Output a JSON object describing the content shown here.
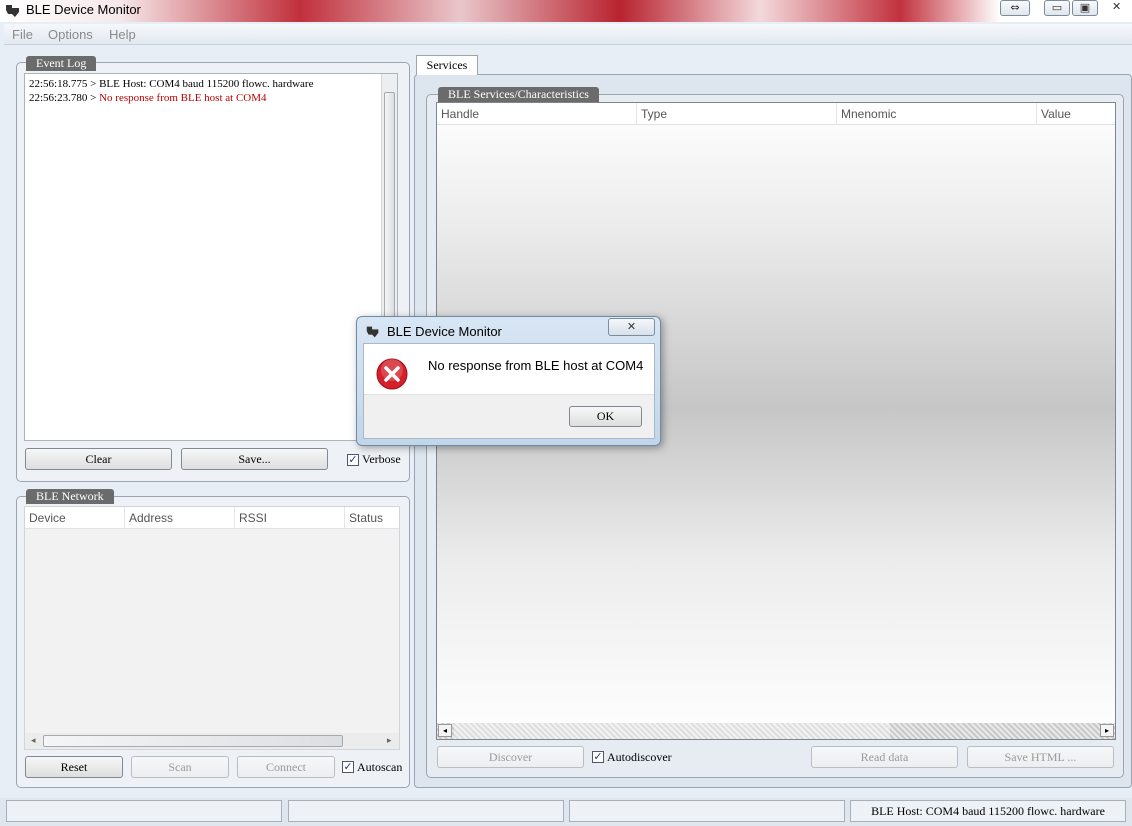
{
  "window": {
    "title": "BLE Device Monitor",
    "controls": {
      "restore_glyph": "⇔",
      "minimize_glyph": "▭",
      "maximize_glyph": "▣",
      "close_glyph": "✕"
    }
  },
  "menu": {
    "items": [
      "File",
      "Options",
      "Help"
    ]
  },
  "event_log": {
    "title": "Event Log",
    "lines": [
      {
        "time": "22:56:18.775",
        "text": "BLE Host: COM4 baud 115200 flowc. hardware",
        "color": "#000000"
      },
      {
        "time": "22:56:23.780",
        "text": "No response from BLE host at COM4",
        "color": "#c00000"
      }
    ],
    "clear_label": "Clear",
    "save_label": "Save...",
    "verbose_label": "Verbose",
    "verbose_checked": true
  },
  "ble_network": {
    "title": "BLE Network",
    "columns": [
      "Device",
      "Address",
      "RSSI",
      "Status"
    ],
    "reset_label": "Reset",
    "scan_label": "Scan",
    "connect_label": "Connect",
    "autoscan_label": "Autoscan",
    "autoscan_checked": true
  },
  "services": {
    "tab_label": "Services",
    "group_title": "BLE Services/Characteristics",
    "columns": [
      "Handle",
      "Type",
      "Mnenomic",
      "Value"
    ],
    "discover_label": "Discover",
    "autodiscover_label": "Autodiscover",
    "autodiscover_checked": true,
    "read_label": "Read data",
    "save_html_label": "Save HTML ..."
  },
  "status_bar": {
    "host_text": "BLE Host: COM4 baud 115200 flowc. hardware"
  },
  "dialog": {
    "title": "BLE Device Monitor",
    "message": "No response from BLE host at COM4",
    "ok_label": "OK",
    "close_glyph": "✕",
    "icon_color": "#d4202a"
  }
}
